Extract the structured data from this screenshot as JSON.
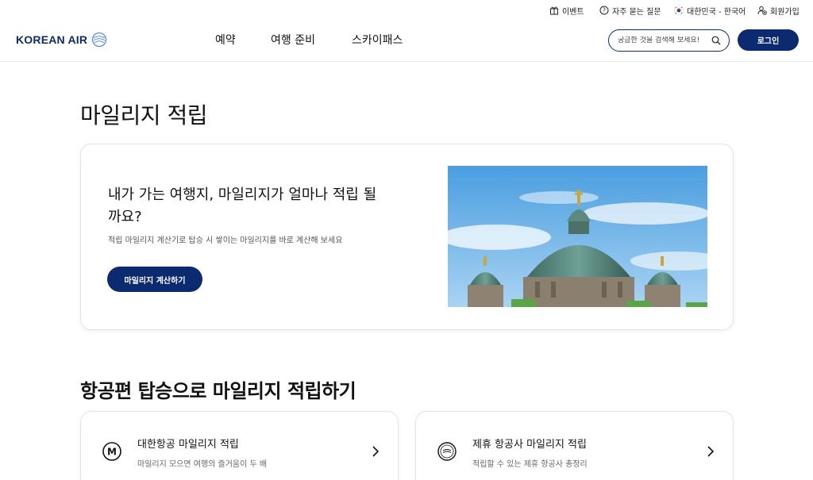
{
  "utility": {
    "events": "이벤트",
    "faq": "자주 묻는 질문",
    "region": "대한민국 - 한국어",
    "signup": "회원가입"
  },
  "header": {
    "logo": "KOREAN AIR",
    "nav": [
      "예약",
      "여행 준비",
      "스카이패스"
    ],
    "search_placeholder": "궁금한 것을 검색해 보세요!",
    "login": "로그인"
  },
  "main": {
    "page_title": "마일리지 적립",
    "hero": {
      "heading": "내가 가는 여행지, 마일리지가 얼마나 적립 될까요?",
      "subtitle": "적립 마일리지 계산기로 탑승 시 쌓이는 마일리지를 바로 계산해 보세요",
      "button": "마일리지 계산하기"
    },
    "section_title": "항공편 탑승으로 마일리지 적립하기",
    "cards": [
      {
        "title": "대한항공 마일리지 적립",
        "desc": "마일리지 모으면 여행의 즐거움이 두 배",
        "icon": "m-circle-icon"
      },
      {
        "title": "제휴 항공사 마일리지 적립",
        "desc": "적립할 수 있는 제휴 항공사 총정리",
        "icon": "partner-airline-icon"
      }
    ]
  },
  "colors": {
    "brand_navy": "#0c2a70",
    "logo_blue": "#5b8fd6"
  }
}
